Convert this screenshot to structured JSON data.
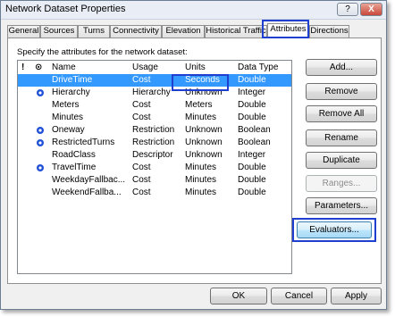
{
  "window": {
    "title": "Network Dataset Properties",
    "help": "?",
    "close": "X"
  },
  "tabs": [
    "General",
    "Sources",
    "Turns",
    "Connectivity",
    "Elevation",
    "Historical Traffic",
    "Attributes",
    "Directions"
  ],
  "active_tab": "Attributes",
  "instruction": "Specify the attributes for the network dataset:",
  "list": {
    "header_icons": {
      "warning": "!",
      "default": "⊙"
    },
    "columns": [
      "Name",
      "Usage",
      "Units",
      "Data Type"
    ],
    "rows": [
      {
        "name": "DriveTime",
        "usage": "Cost",
        "units": "Seconds",
        "type": "Double",
        "default": false,
        "selected": true
      },
      {
        "name": "Hierarchy",
        "usage": "Hierarchy",
        "units": "Unknown",
        "type": "Integer",
        "default": true,
        "selected": false
      },
      {
        "name": "Meters",
        "usage": "Cost",
        "units": "Meters",
        "type": "Double",
        "default": false,
        "selected": false
      },
      {
        "name": "Minutes",
        "usage": "Cost",
        "units": "Minutes",
        "type": "Double",
        "default": false,
        "selected": false
      },
      {
        "name": "Oneway",
        "usage": "Restriction",
        "units": "Unknown",
        "type": "Boolean",
        "default": true,
        "selected": false
      },
      {
        "name": "RestrictedTurns",
        "usage": "Restriction",
        "units": "Unknown",
        "type": "Boolean",
        "default": true,
        "selected": false
      },
      {
        "name": "RoadClass",
        "usage": "Descriptor",
        "units": "Unknown",
        "type": "Integer",
        "default": false,
        "selected": false
      },
      {
        "name": "TravelTime",
        "usage": "Cost",
        "units": "Minutes",
        "type": "Double",
        "default": true,
        "selected": false
      },
      {
        "name": "WeekdayFallbac...",
        "usage": "Cost",
        "units": "Minutes",
        "type": "Double",
        "default": false,
        "selected": false
      },
      {
        "name": "WeekendFallba...",
        "usage": "Cost",
        "units": "Minutes",
        "type": "Double",
        "default": false,
        "selected": false
      }
    ]
  },
  "buttons": {
    "add": "Add...",
    "remove": "Remove",
    "remove_all": "Remove All",
    "rename": "Rename",
    "duplicate": "Duplicate",
    "ranges": "Ranges...",
    "parameters": "Parameters...",
    "evaluators": "Evaluators...",
    "ok": "OK",
    "cancel": "Cancel",
    "apply": "Apply"
  },
  "colors": {
    "selection": "#3399ff",
    "highlight_box": "#1f3fd0",
    "default_icon": "#1f50d6"
  }
}
